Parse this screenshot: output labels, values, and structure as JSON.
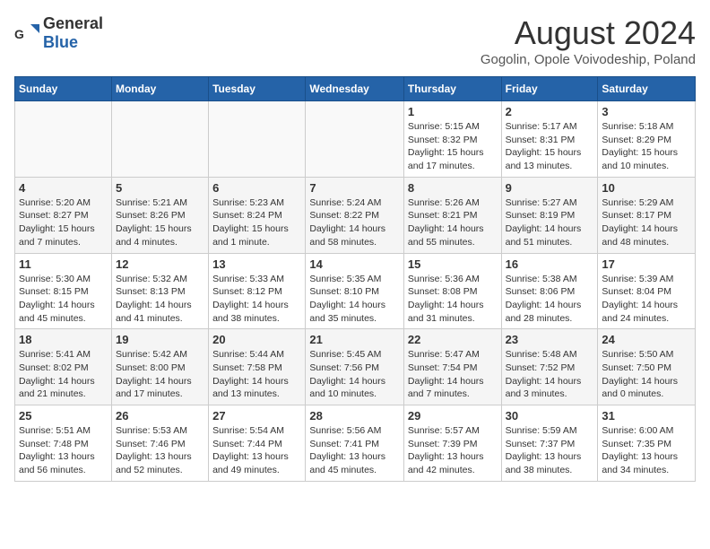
{
  "header": {
    "logo_general": "General",
    "logo_blue": "Blue",
    "title": "August 2024",
    "subtitle": "Gogolin, Opole Voivodeship, Poland"
  },
  "weekdays": [
    "Sunday",
    "Monday",
    "Tuesday",
    "Wednesday",
    "Thursday",
    "Friday",
    "Saturday"
  ],
  "weeks": [
    [
      {
        "day": "",
        "info": ""
      },
      {
        "day": "",
        "info": ""
      },
      {
        "day": "",
        "info": ""
      },
      {
        "day": "",
        "info": ""
      },
      {
        "day": "1",
        "info": "Sunrise: 5:15 AM\nSunset: 8:32 PM\nDaylight: 15 hours and 17 minutes."
      },
      {
        "day": "2",
        "info": "Sunrise: 5:17 AM\nSunset: 8:31 PM\nDaylight: 15 hours and 13 minutes."
      },
      {
        "day": "3",
        "info": "Sunrise: 5:18 AM\nSunset: 8:29 PM\nDaylight: 15 hours and 10 minutes."
      }
    ],
    [
      {
        "day": "4",
        "info": "Sunrise: 5:20 AM\nSunset: 8:27 PM\nDaylight: 15 hours and 7 minutes."
      },
      {
        "day": "5",
        "info": "Sunrise: 5:21 AM\nSunset: 8:26 PM\nDaylight: 15 hours and 4 minutes."
      },
      {
        "day": "6",
        "info": "Sunrise: 5:23 AM\nSunset: 8:24 PM\nDaylight: 15 hours and 1 minute."
      },
      {
        "day": "7",
        "info": "Sunrise: 5:24 AM\nSunset: 8:22 PM\nDaylight: 14 hours and 58 minutes."
      },
      {
        "day": "8",
        "info": "Sunrise: 5:26 AM\nSunset: 8:21 PM\nDaylight: 14 hours and 55 minutes."
      },
      {
        "day": "9",
        "info": "Sunrise: 5:27 AM\nSunset: 8:19 PM\nDaylight: 14 hours and 51 minutes."
      },
      {
        "day": "10",
        "info": "Sunrise: 5:29 AM\nSunset: 8:17 PM\nDaylight: 14 hours and 48 minutes."
      }
    ],
    [
      {
        "day": "11",
        "info": "Sunrise: 5:30 AM\nSunset: 8:15 PM\nDaylight: 14 hours and 45 minutes."
      },
      {
        "day": "12",
        "info": "Sunrise: 5:32 AM\nSunset: 8:13 PM\nDaylight: 14 hours and 41 minutes."
      },
      {
        "day": "13",
        "info": "Sunrise: 5:33 AM\nSunset: 8:12 PM\nDaylight: 14 hours and 38 minutes."
      },
      {
        "day": "14",
        "info": "Sunrise: 5:35 AM\nSunset: 8:10 PM\nDaylight: 14 hours and 35 minutes."
      },
      {
        "day": "15",
        "info": "Sunrise: 5:36 AM\nSunset: 8:08 PM\nDaylight: 14 hours and 31 minutes."
      },
      {
        "day": "16",
        "info": "Sunrise: 5:38 AM\nSunset: 8:06 PM\nDaylight: 14 hours and 28 minutes."
      },
      {
        "day": "17",
        "info": "Sunrise: 5:39 AM\nSunset: 8:04 PM\nDaylight: 14 hours and 24 minutes."
      }
    ],
    [
      {
        "day": "18",
        "info": "Sunrise: 5:41 AM\nSunset: 8:02 PM\nDaylight: 14 hours and 21 minutes."
      },
      {
        "day": "19",
        "info": "Sunrise: 5:42 AM\nSunset: 8:00 PM\nDaylight: 14 hours and 17 minutes."
      },
      {
        "day": "20",
        "info": "Sunrise: 5:44 AM\nSunset: 7:58 PM\nDaylight: 14 hours and 13 minutes."
      },
      {
        "day": "21",
        "info": "Sunrise: 5:45 AM\nSunset: 7:56 PM\nDaylight: 14 hours and 10 minutes."
      },
      {
        "day": "22",
        "info": "Sunrise: 5:47 AM\nSunset: 7:54 PM\nDaylight: 14 hours and 7 minutes."
      },
      {
        "day": "23",
        "info": "Sunrise: 5:48 AM\nSunset: 7:52 PM\nDaylight: 14 hours and 3 minutes."
      },
      {
        "day": "24",
        "info": "Sunrise: 5:50 AM\nSunset: 7:50 PM\nDaylight: 14 hours and 0 minutes."
      }
    ],
    [
      {
        "day": "25",
        "info": "Sunrise: 5:51 AM\nSunset: 7:48 PM\nDaylight: 13 hours and 56 minutes."
      },
      {
        "day": "26",
        "info": "Sunrise: 5:53 AM\nSunset: 7:46 PM\nDaylight: 13 hours and 52 minutes."
      },
      {
        "day": "27",
        "info": "Sunrise: 5:54 AM\nSunset: 7:44 PM\nDaylight: 13 hours and 49 minutes."
      },
      {
        "day": "28",
        "info": "Sunrise: 5:56 AM\nSunset: 7:41 PM\nDaylight: 13 hours and 45 minutes."
      },
      {
        "day": "29",
        "info": "Sunrise: 5:57 AM\nSunset: 7:39 PM\nDaylight: 13 hours and 42 minutes."
      },
      {
        "day": "30",
        "info": "Sunrise: 5:59 AM\nSunset: 7:37 PM\nDaylight: 13 hours and 38 minutes."
      },
      {
        "day": "31",
        "info": "Sunrise: 6:00 AM\nSunset: 7:35 PM\nDaylight: 13 hours and 34 minutes."
      }
    ]
  ]
}
